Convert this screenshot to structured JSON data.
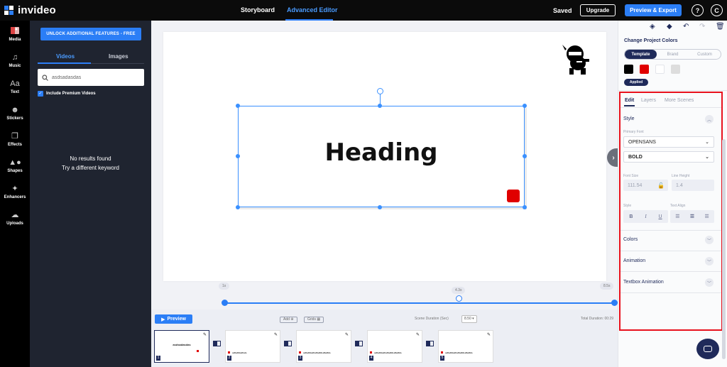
{
  "brand": {
    "name": "invideo"
  },
  "header": {
    "tabs": [
      {
        "label": "Storyboard"
      },
      {
        "label": "Advanced Editor"
      }
    ],
    "saved": "Saved",
    "upgrade": "Upgrade",
    "preview_export": "Preview & Export",
    "help": "?",
    "avatar": "C"
  },
  "rail": {
    "items": [
      {
        "label": "Media",
        "icon": "media-icon"
      },
      {
        "label": "Music",
        "icon": "music-icon"
      },
      {
        "label": "Text",
        "icon": "text-icon",
        "glyph": "Aa"
      },
      {
        "label": "Stickers",
        "icon": "stickers-icon"
      },
      {
        "label": "Effects",
        "icon": "effects-icon"
      },
      {
        "label": "Shapes",
        "icon": "shapes-icon"
      },
      {
        "label": "Enhancers",
        "icon": "enhancers-icon"
      },
      {
        "label": "Uploads",
        "icon": "uploads-icon"
      }
    ]
  },
  "media": {
    "unlock": "UNLOCK ADDITIONAL FEATURES - FREE",
    "tabs": [
      {
        "label": "Videos"
      },
      {
        "label": "Images"
      }
    ],
    "search_value": "asdsadasdas",
    "premium_label": "Include Premium Videos",
    "no_results": "No results found",
    "try_keyword": "Try a different keyword"
  },
  "canvas": {
    "heading": "Heading"
  },
  "timeline": {
    "start": "1s",
    "current": "4.3s",
    "end": "8.5s",
    "preview": "Preview",
    "add": "Add",
    "grids": "Grids",
    "scene_duration_label": "Scene Duration (Sec)",
    "scene_duration_value": "8.50",
    "total_duration": "Total Duration: 00:29",
    "scenes": [
      {
        "num": "1",
        "text": "asdsadasdas"
      },
      {
        "num": "2",
        "text": "sdfsdfdsdfsds"
      },
      {
        "num": "3",
        "text": "sdfsdfdsdfsdfsdfdsdfsdfds"
      },
      {
        "num": "4",
        "text": "sdfsdfdsdfsdfsdfdsdfsdfds"
      },
      {
        "num": "5",
        "text": "sdfsdfdsdfsdfsdfdsdfsdfds"
      }
    ]
  },
  "right": {
    "title": "Change Project Colors",
    "seg": [
      "Template",
      "Brand",
      "Custom"
    ],
    "swatches": [
      "#000000",
      "#e00000",
      "#ffffff",
      "#dddddd"
    ],
    "applied": "Applied",
    "tabs": [
      "Edit",
      "Layers",
      "More Scenes"
    ],
    "style_title": "Style",
    "primary_font_label": "Primary Font",
    "font": "OPENSANS",
    "weight": "BOLD",
    "font_size_label": "Font Size",
    "font_size": "111.54",
    "line_height_label": "Line Height",
    "line_height": "1.4",
    "style_label": "Style",
    "align_label": "Text Align",
    "colors": "Colors",
    "animation": "Animation",
    "textbox_animation": "Textbox Animation"
  }
}
